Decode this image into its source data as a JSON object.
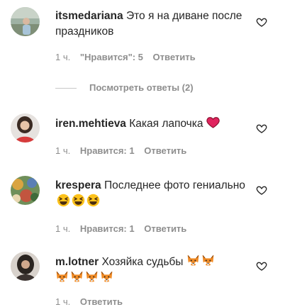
{
  "comments": [
    {
      "username": "itsmedariana",
      "text": "Это я на диване после праздников",
      "time": "1 ч.",
      "likes": "\"Нравится\": 5",
      "reply": "Ответить",
      "avatar_icon": "avatar-outdoor-photo",
      "emojis": []
    },
    {
      "username": "iren.mehtieva",
      "text": "Какая лапочка",
      "time": "1 ч.",
      "likes": "Нравится: 1",
      "reply": "Ответить",
      "avatar_icon": "avatar-portrait-photo",
      "emojis": [
        "red-heart"
      ]
    },
    {
      "username": "krespera",
      "text": "Последнее фото гениально",
      "time": "1 ч.",
      "likes": "Нравится: 1",
      "reply": "Ответить",
      "avatar_icon": "avatar-colorful-photo",
      "emojis": [
        "laughing-squint-face",
        "laughing-squint-face",
        "laughing-squint-face"
      ]
    },
    {
      "username": "m.lotner",
      "text": "Хозяйка судьбы",
      "time": "1 ч.",
      "likes": "",
      "reply": "Ответить",
      "avatar_icon": "avatar-dark-photo",
      "emojis": [
        "fox-face",
        "fox-face",
        "fox-face",
        "fox-face",
        "fox-face",
        "fox-face"
      ]
    }
  ],
  "view_replies": "Посмотреть ответы (2)",
  "colors": {
    "text": "#262626",
    "meta": "#8e8e8e",
    "heart": "#e0245e"
  }
}
